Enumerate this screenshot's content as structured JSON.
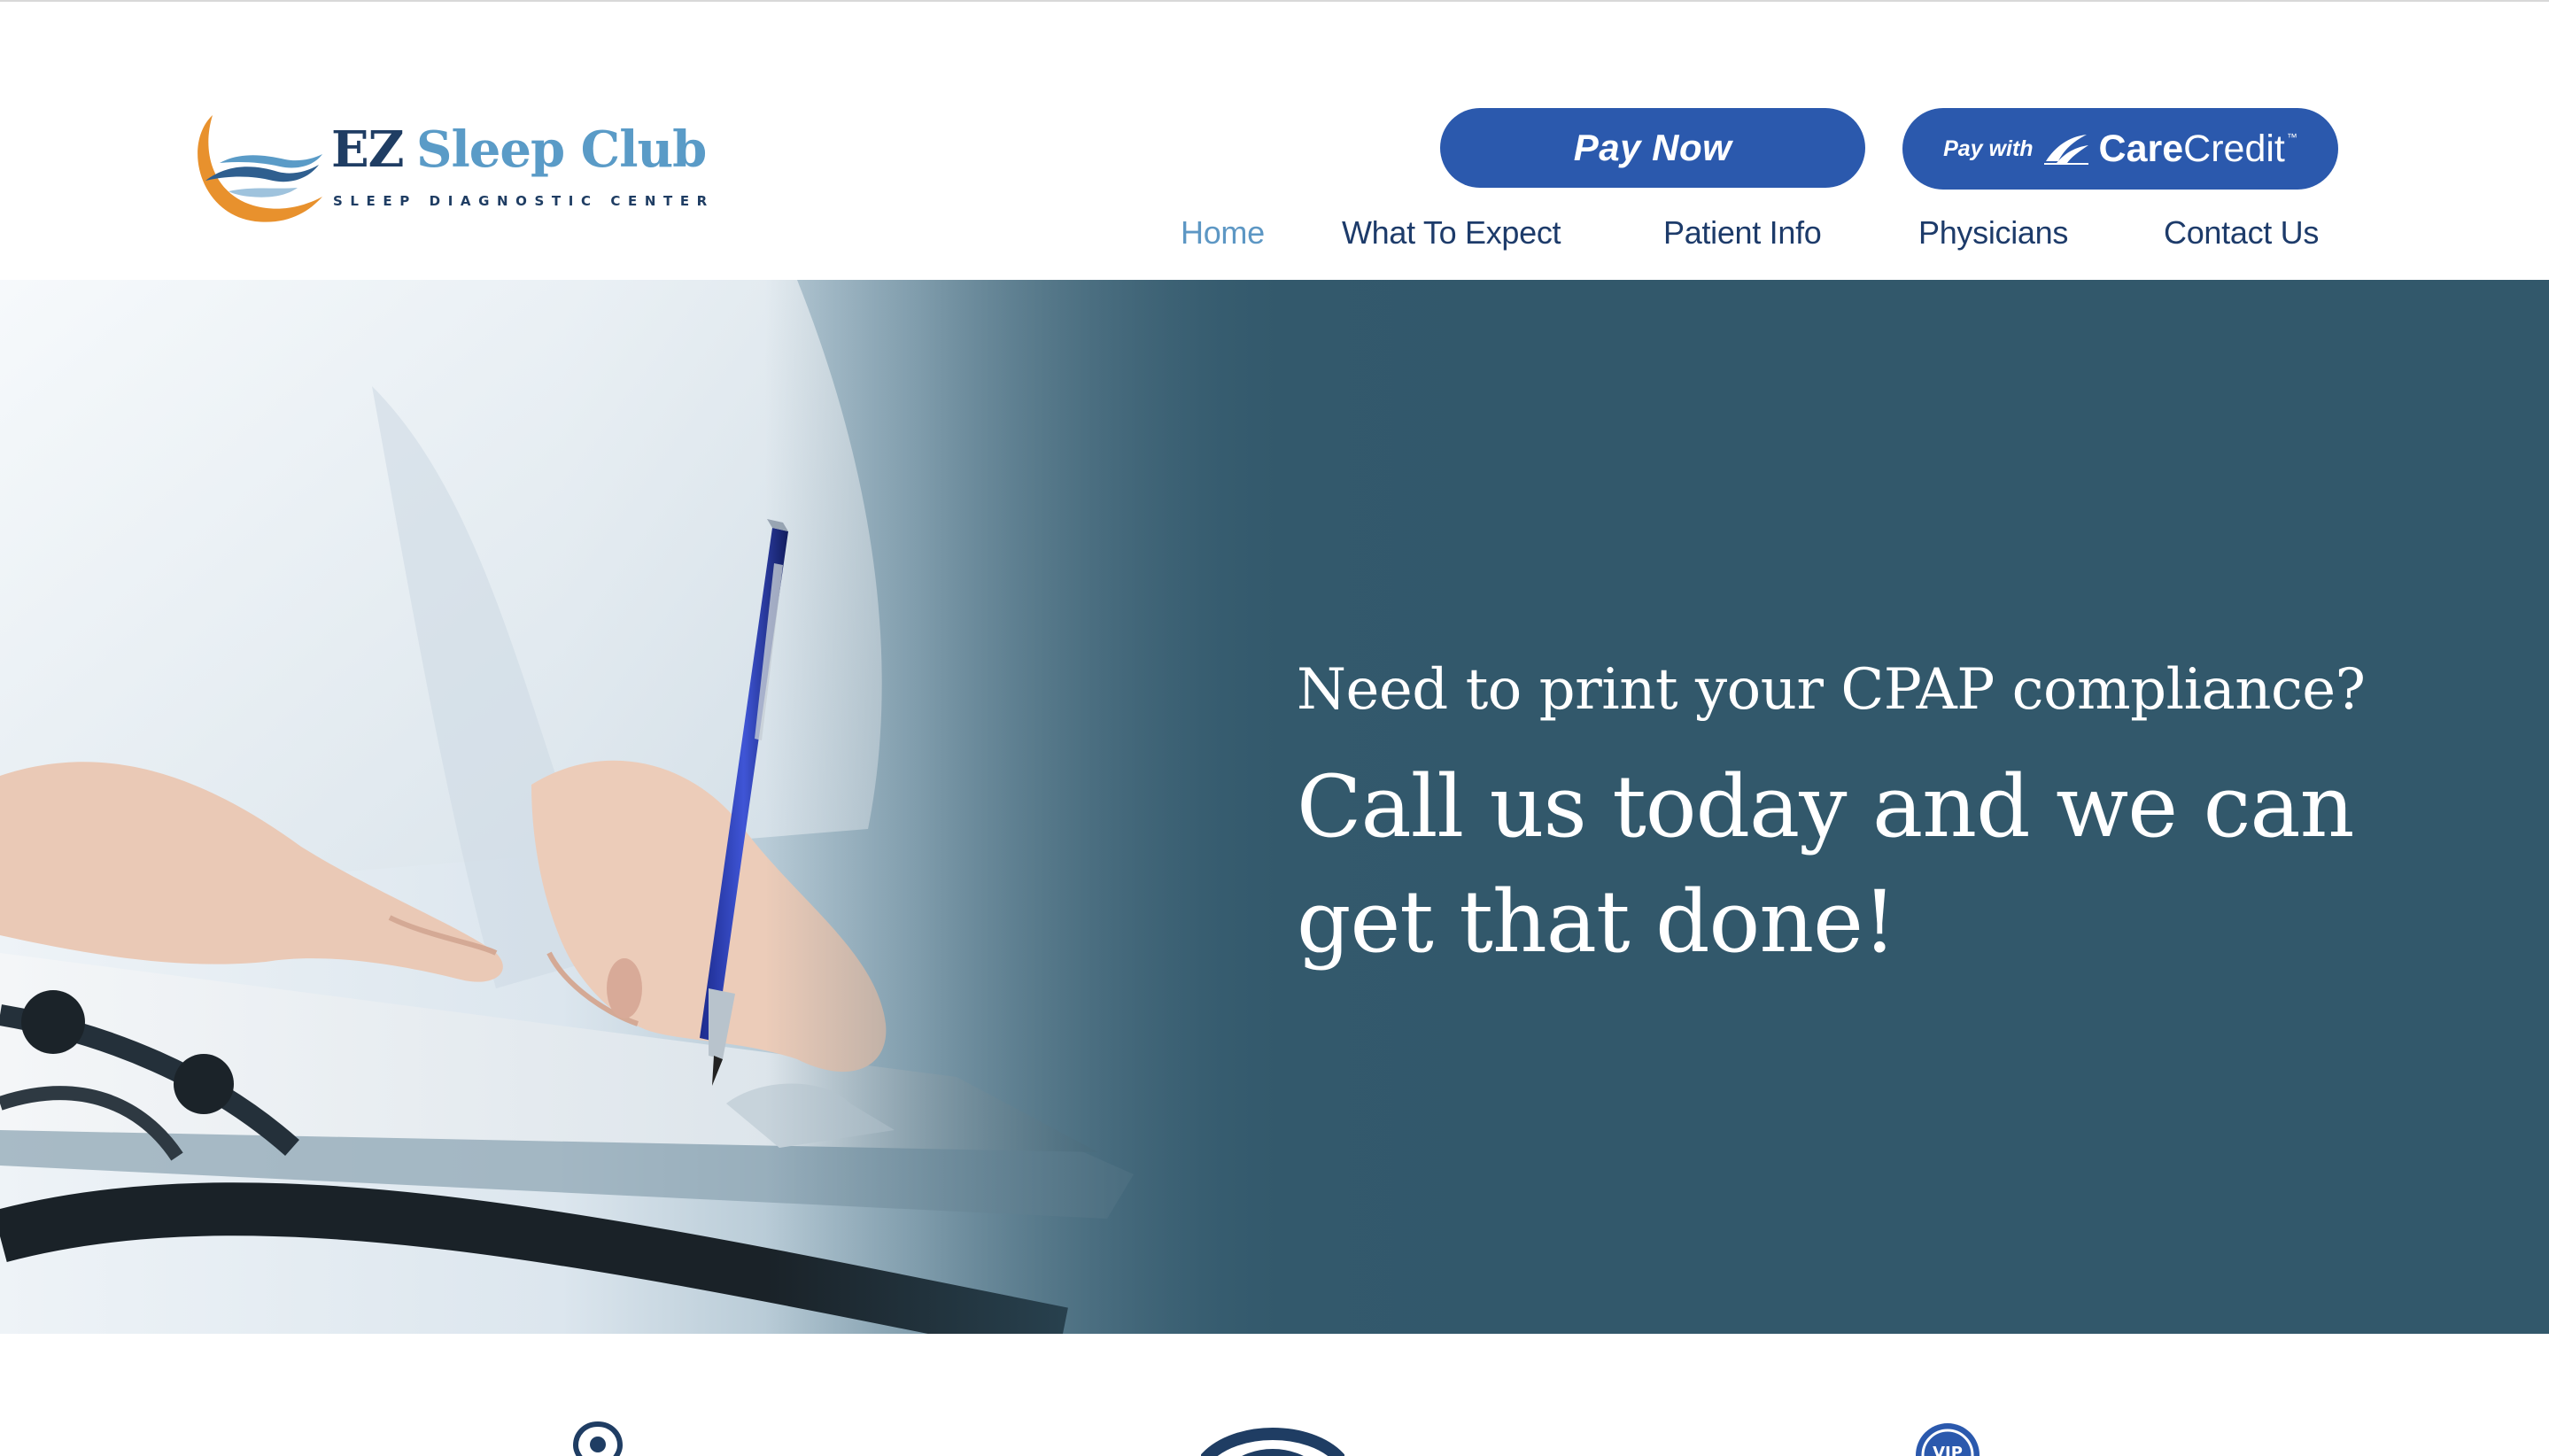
{
  "header": {
    "logo": {
      "title_ez": "EZ",
      "title_name": "Sleep Club",
      "subtitle": "SLEEP DIAGNOSTIC CENTER"
    },
    "pay_now_label": "Pay Now",
    "carecredit": {
      "prefix": "Pay with",
      "brand_bold": "Care",
      "brand_light": "Credit",
      "trademark": "™"
    },
    "nav": [
      {
        "label": "Home",
        "active": true
      },
      {
        "label": "What To Expect",
        "active": false
      },
      {
        "label": "Patient Info",
        "active": false
      },
      {
        "label": "Physicians",
        "active": false
      },
      {
        "label": "Contact Us",
        "active": false
      }
    ]
  },
  "hero": {
    "subheading": "Need to print your CPAP compliance?",
    "heading": "Call us today and we can get that done!"
  },
  "feature_icons": [
    "location-pin-icon",
    "wifi-signal-icon",
    "vip-badge-icon"
  ],
  "colors": {
    "brand_blue": "#2b59ad",
    "nav_text": "#1d3b6a",
    "nav_active": "#5d97c4",
    "hero_bg": "#32586b",
    "logo_orange": "#e8912d"
  }
}
